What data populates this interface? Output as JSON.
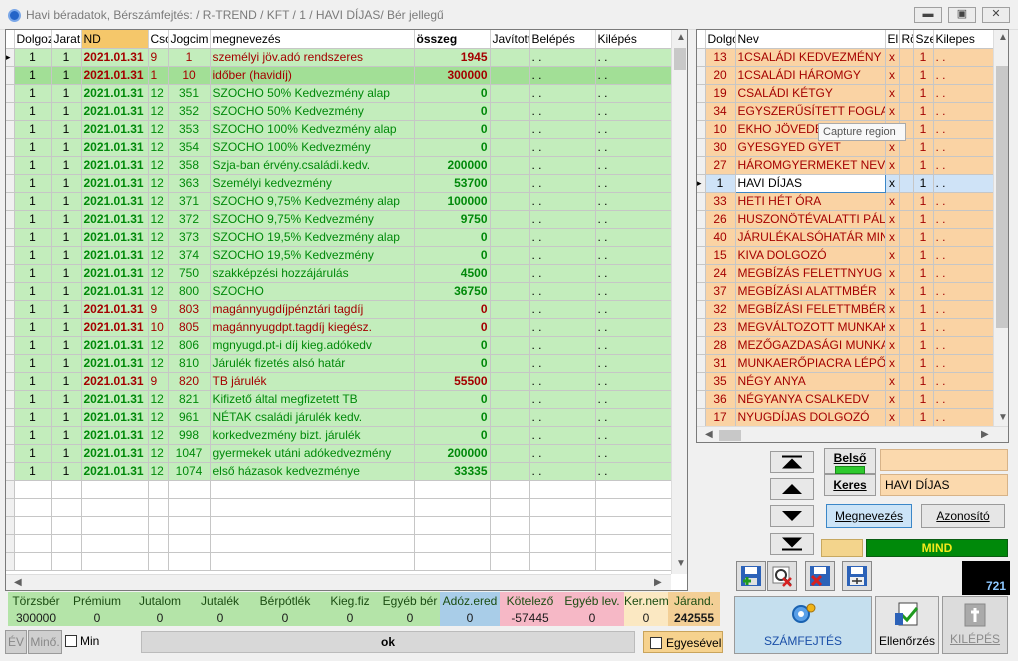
{
  "window": {
    "title": "Havi béradatok, Bérszámfejtés: / R-TREND / KFT / 1 / HAVI DÍJAS/ Bér jellegű",
    "min_icon": "minimize-icon",
    "max_icon": "maximize-icon",
    "close_icon": "close-icon"
  },
  "left_grid": {
    "headers": [
      "Dolgoz",
      "Jarat",
      "ND",
      "",
      "Cso",
      "Jogcim",
      "megnevezés",
      "összeg",
      "Javított",
      "Belépés",
      "Kilépés"
    ],
    "rows": [
      {
        "d": "1",
        "j": "1",
        "date": "2021.01.31",
        "cso": "9",
        "jc": "1",
        "name": "személyi jöv.adó rendszeres",
        "amt": "1945",
        "be": ". .",
        "ki": ". .",
        "style": "green",
        "color": "red",
        "cur": true
      },
      {
        "d": "1",
        "j": "1",
        "date": "2021.01.31",
        "cso": "1",
        "jc": "10",
        "name": "időber (havidíj)",
        "amt": "300000",
        "be": ". .",
        "ki": ". .",
        "style": "green2",
        "color": "red"
      },
      {
        "d": "1",
        "j": "1",
        "date": "2021.01.31",
        "cso": "12",
        "jc": "351",
        "name": "SZOCHO  50%  Kedvezmény alap",
        "amt": "0",
        "be": ". .",
        "ki": ". .",
        "style": "green",
        "color": "grn"
      },
      {
        "d": "1",
        "j": "1",
        "date": "2021.01.31",
        "cso": "12",
        "jc": "352",
        "name": "SZOCHO  50%  Kedvezmény",
        "amt": "0",
        "be": ". .",
        "ki": ". .",
        "style": "green",
        "color": "grn"
      },
      {
        "d": "1",
        "j": "1",
        "date": "2021.01.31",
        "cso": "12",
        "jc": "353",
        "name": "SZOCHO 100%  Kedvezmény alap",
        "amt": "0",
        "be": ". .",
        "ki": ". .",
        "style": "green",
        "color": "grn"
      },
      {
        "d": "1",
        "j": "1",
        "date": "2021.01.31",
        "cso": "12",
        "jc": "354",
        "name": "SZOCHO 100%  Kedvezmény",
        "amt": "0",
        "be": ". .",
        "ki": ". .",
        "style": "green",
        "color": "grn"
      },
      {
        "d": "1",
        "j": "1",
        "date": "2021.01.31",
        "cso": "12",
        "jc": "358",
        "name": "Szja-ban érvény.családi.kedv.",
        "amt": "200000",
        "be": ". .",
        "ki": ". .",
        "style": "green",
        "color": "grn"
      },
      {
        "d": "1",
        "j": "1",
        "date": "2021.01.31",
        "cso": "12",
        "jc": "363",
        "name": "Személyi kedvezmény",
        "amt": "53700",
        "be": ". .",
        "ki": ". .",
        "style": "green",
        "color": "grn"
      },
      {
        "d": "1",
        "j": "1",
        "date": "2021.01.31",
        "cso": "12",
        "jc": "371",
        "name": "SZOCHO 9,75% Kedvezmény alap",
        "amt": "100000",
        "be": ". .",
        "ki": ". .",
        "style": "green",
        "color": "grn"
      },
      {
        "d": "1",
        "j": "1",
        "date": "2021.01.31",
        "cso": "12",
        "jc": "372",
        "name": "SZOCHO 9,75% Kedvezmény",
        "amt": "9750",
        "be": ". .",
        "ki": ". .",
        "style": "green",
        "color": "grn"
      },
      {
        "d": "1",
        "j": "1",
        "date": "2021.01.31",
        "cso": "12",
        "jc": "373",
        "name": "SZOCHO 19,5% Kedvezmény alap",
        "amt": "0",
        "be": ". .",
        "ki": ". .",
        "style": "green",
        "color": "grn"
      },
      {
        "d": "1",
        "j": "1",
        "date": "2021.01.31",
        "cso": "12",
        "jc": "374",
        "name": "SZOCHO 19,5% Kedvezmény",
        "amt": "0",
        "be": ". .",
        "ki": ". .",
        "style": "green",
        "color": "grn"
      },
      {
        "d": "1",
        "j": "1",
        "date": "2021.01.31",
        "cso": "12",
        "jc": "750",
        "name": "szakképzési hozzájárulás",
        "amt": "4500",
        "be": ". .",
        "ki": ". .",
        "style": "green",
        "color": "grn"
      },
      {
        "d": "1",
        "j": "1",
        "date": "2021.01.31",
        "cso": "12",
        "jc": "800",
        "name": "SZOCHO",
        "amt": "36750",
        "be": ". .",
        "ki": ". .",
        "style": "green",
        "color": "grn"
      },
      {
        "d": "1",
        "j": "1",
        "date": "2021.01.31",
        "cso": "9",
        "jc": "803",
        "name": "magánnyugdíjpénztári tagdíj",
        "amt": "0",
        "be": ". .",
        "ki": ". .",
        "style": "green",
        "color": "red"
      },
      {
        "d": "1",
        "j": "1",
        "date": "2021.01.31",
        "cso": "10",
        "jc": "805",
        "name": "magánnyugdpt.tagdíj kiegész.",
        "amt": "0",
        "be": ". .",
        "ki": ". .",
        "style": "green",
        "color": "red"
      },
      {
        "d": "1",
        "j": "1",
        "date": "2021.01.31",
        "cso": "12",
        "jc": "806",
        "name": "mgnyugd.pt-i díj kieg.adókedv",
        "amt": "0",
        "be": ". .",
        "ki": ". .",
        "style": "green",
        "color": "grn"
      },
      {
        "d": "1",
        "j": "1",
        "date": "2021.01.31",
        "cso": "12",
        "jc": "810",
        "name": "Járulék fizetés alsó határ",
        "amt": "0",
        "be": ". .",
        "ki": ". .",
        "style": "green",
        "color": "grn"
      },
      {
        "d": "1",
        "j": "1",
        "date": "2021.01.31",
        "cso": "9",
        "jc": "820",
        "name": "TB járulék",
        "amt": "55500",
        "be": ". .",
        "ki": ". .",
        "style": "green",
        "color": "red"
      },
      {
        "d": "1",
        "j": "1",
        "date": "2021.01.31",
        "cso": "12",
        "jc": "821",
        "name": "Kifizető által megfizetett TB",
        "amt": "0",
        "be": ". .",
        "ki": ". .",
        "style": "green",
        "color": "grn"
      },
      {
        "d": "1",
        "j": "1",
        "date": "2021.01.31",
        "cso": "12",
        "jc": "961",
        "name": "NÉTAK családi járulék kedv.",
        "amt": "0",
        "be": ". .",
        "ki": ". .",
        "style": "green",
        "color": "grn"
      },
      {
        "d": "1",
        "j": "1",
        "date": "2021.01.31",
        "cso": "12",
        "jc": "998",
        "name": "korkedvezmény bizt. járulék",
        "amt": "0",
        "be": ". .",
        "ki": ". .",
        "style": "green",
        "color": "grn"
      },
      {
        "d": "1",
        "j": "1",
        "date": "2021.01.31",
        "cso": "12",
        "jc": "1047",
        "name": "gyermekek utáni adókedvezmény",
        "amt": "200000",
        "be": ". .",
        "ki": ". .",
        "style": "green",
        "color": "grn"
      },
      {
        "d": "1",
        "j": "1",
        "date": "2021.01.31",
        "cso": "12",
        "jc": "1074",
        "name": "első házasok kedvezménye",
        "amt": "33335",
        "be": ". .",
        "ki": ". .",
        "style": "green",
        "color": "grn"
      }
    ],
    "empty_rows": 5
  },
  "right_grid": {
    "headers": [
      "Dolgo",
      "Nev",
      "El",
      "Rö",
      "Sze",
      "Kilepes"
    ],
    "rows": [
      {
        "id": "13",
        "name": "1CSALÁDI  KEDVEZMÉNY",
        "x": "x",
        "s": "1",
        "k": ". ."
      },
      {
        "id": "20",
        "name": "1CSALÁDI HÁROMGY",
        "x": "x",
        "s": "1",
        "k": ". ."
      },
      {
        "id": "19",
        "name": "CSALÁDI KÉTGY",
        "x": "x",
        "s": "1",
        "k": ". ."
      },
      {
        "id": "34",
        "name": "EGYSZERŰSÍTETT FOGLA",
        "x": "x",
        "s": "1",
        "k": ". ."
      },
      {
        "id": "10",
        "name": "EKHO JÖVEDE",
        "x": "x",
        "s": "1",
        "k": ". ."
      },
      {
        "id": "30",
        "name": "GYESGYED GYET",
        "x": "x",
        "s": "1",
        "k": ". ."
      },
      {
        "id": "27",
        "name": "HÁROMGYERMEKET NEVE",
        "x": "x",
        "s": "1",
        "k": ". ."
      },
      {
        "id": "1",
        "name": "HAVI DÍJAS",
        "x": "x",
        "s": "1",
        "k": ". .",
        "sel": true
      },
      {
        "id": "33",
        "name": "HETI HÉT ÓRA",
        "x": "x",
        "s": "1",
        "k": ". ."
      },
      {
        "id": "26",
        "name": "HUSZONÖTÉVALATTI  PÁL",
        "x": "x",
        "s": "1",
        "k": ". ."
      },
      {
        "id": "40",
        "name": "JÁRULÉKALSÓHATÁR  MIN",
        "x": "x",
        "s": "1",
        "k": ". ."
      },
      {
        "id": "15",
        "name": "KIVA DOLGOZÓ",
        "x": "x",
        "s": "1",
        "k": ". ."
      },
      {
        "id": "24",
        "name": "MEGBÍZÁS FELETTNYUG",
        "x": "x",
        "s": "1",
        "k": ". ."
      },
      {
        "id": "37",
        "name": "MEGBÍZÁSI ALATTMBÉR",
        "x": "x",
        "s": "1",
        "k": ". ."
      },
      {
        "id": "32",
        "name": "MEGBÍZÁSI FELETTMBÉR",
        "x": "x",
        "s": "1",
        "k": ". ."
      },
      {
        "id": "23",
        "name": "MEGVÁLTOZOTT MUNKAK",
        "x": "x",
        "s": "1",
        "k": ". ."
      },
      {
        "id": "28",
        "name": "MEZŐGAZDASÁGI MUNKAI",
        "x": "x",
        "s": "1",
        "k": ". ."
      },
      {
        "id": "31",
        "name": "MUNKAERŐPIACRA LÉPŐ",
        "x": "x",
        "s": "1",
        "k": ". ."
      },
      {
        "id": "35",
        "name": "NÉGY ANYA",
        "x": "x",
        "s": "1",
        "k": ". ."
      },
      {
        "id": "36",
        "name": "NÉGYANYA CSALKEDV",
        "x": "x",
        "s": "1",
        "k": ". ."
      },
      {
        "id": "17",
        "name": "NYUGDÍJAS DOLGOZÓ",
        "x": "x",
        "s": "1",
        "k": ". ."
      }
    ],
    "tooltip": "Capture region"
  },
  "summary": {
    "cells": [
      {
        "label": "Törzsbér",
        "value": "300000",
        "bg": "#b4e4a8"
      },
      {
        "label": "Prémium",
        "value": "0",
        "bg": "#b4e4a8"
      },
      {
        "label": "Jutalom",
        "value": "0",
        "bg": "#b4e4a8"
      },
      {
        "label": "Jutalék",
        "value": "0",
        "bg": "#b4e4a8"
      },
      {
        "label": "Bérpótlék",
        "value": "0",
        "bg": "#b4e4a8"
      },
      {
        "label": "Kieg.fiz",
        "value": "0",
        "bg": "#b4e4a8"
      },
      {
        "label": "Egyéb bér",
        "value": "0",
        "bg": "#b4e4a8"
      },
      {
        "label": "Adóz.ered",
        "value": "0",
        "bg": "#a9cde8"
      },
      {
        "label": "Kötelező",
        "value": "-57445",
        "bg": "#f6b8c6"
      },
      {
        "label": "Egyéb lev.",
        "value": "0",
        "bg": "#f6b8c6"
      },
      {
        "label": "Ker.nem",
        "value": "0",
        "bg": "#fbe8c2"
      },
      {
        "label": "Járand.",
        "value": "242555",
        "bg": "#f3cf96"
      }
    ]
  },
  "bottom": {
    "ev": "ÉV",
    "mino": "Minő.",
    "min": "Min",
    "status": "ok",
    "egyesevel": "Egyesével"
  },
  "right_panel": {
    "belso": "Belső",
    "keres": "Keres",
    "search_value": "HAVI DÍJAS",
    "megnevezes": "Megnevezés",
    "azonosito": "Azonosító",
    "mind": "MIND",
    "counter": "721",
    "szamfejtes": "SZÁMFEJTÉS",
    "ellenorzes": "Ellenőrzés",
    "kilepes": "KILÉPÉS"
  },
  "colors": {
    "green_row": "#c3edbc",
    "selected_green": "#a2df96",
    "orange_row": "#fad3a4",
    "red_text": "#a40000",
    "green_text": "#00890a",
    "mind_bg": "#00890a",
    "mind_text": "#f3e91c"
  }
}
